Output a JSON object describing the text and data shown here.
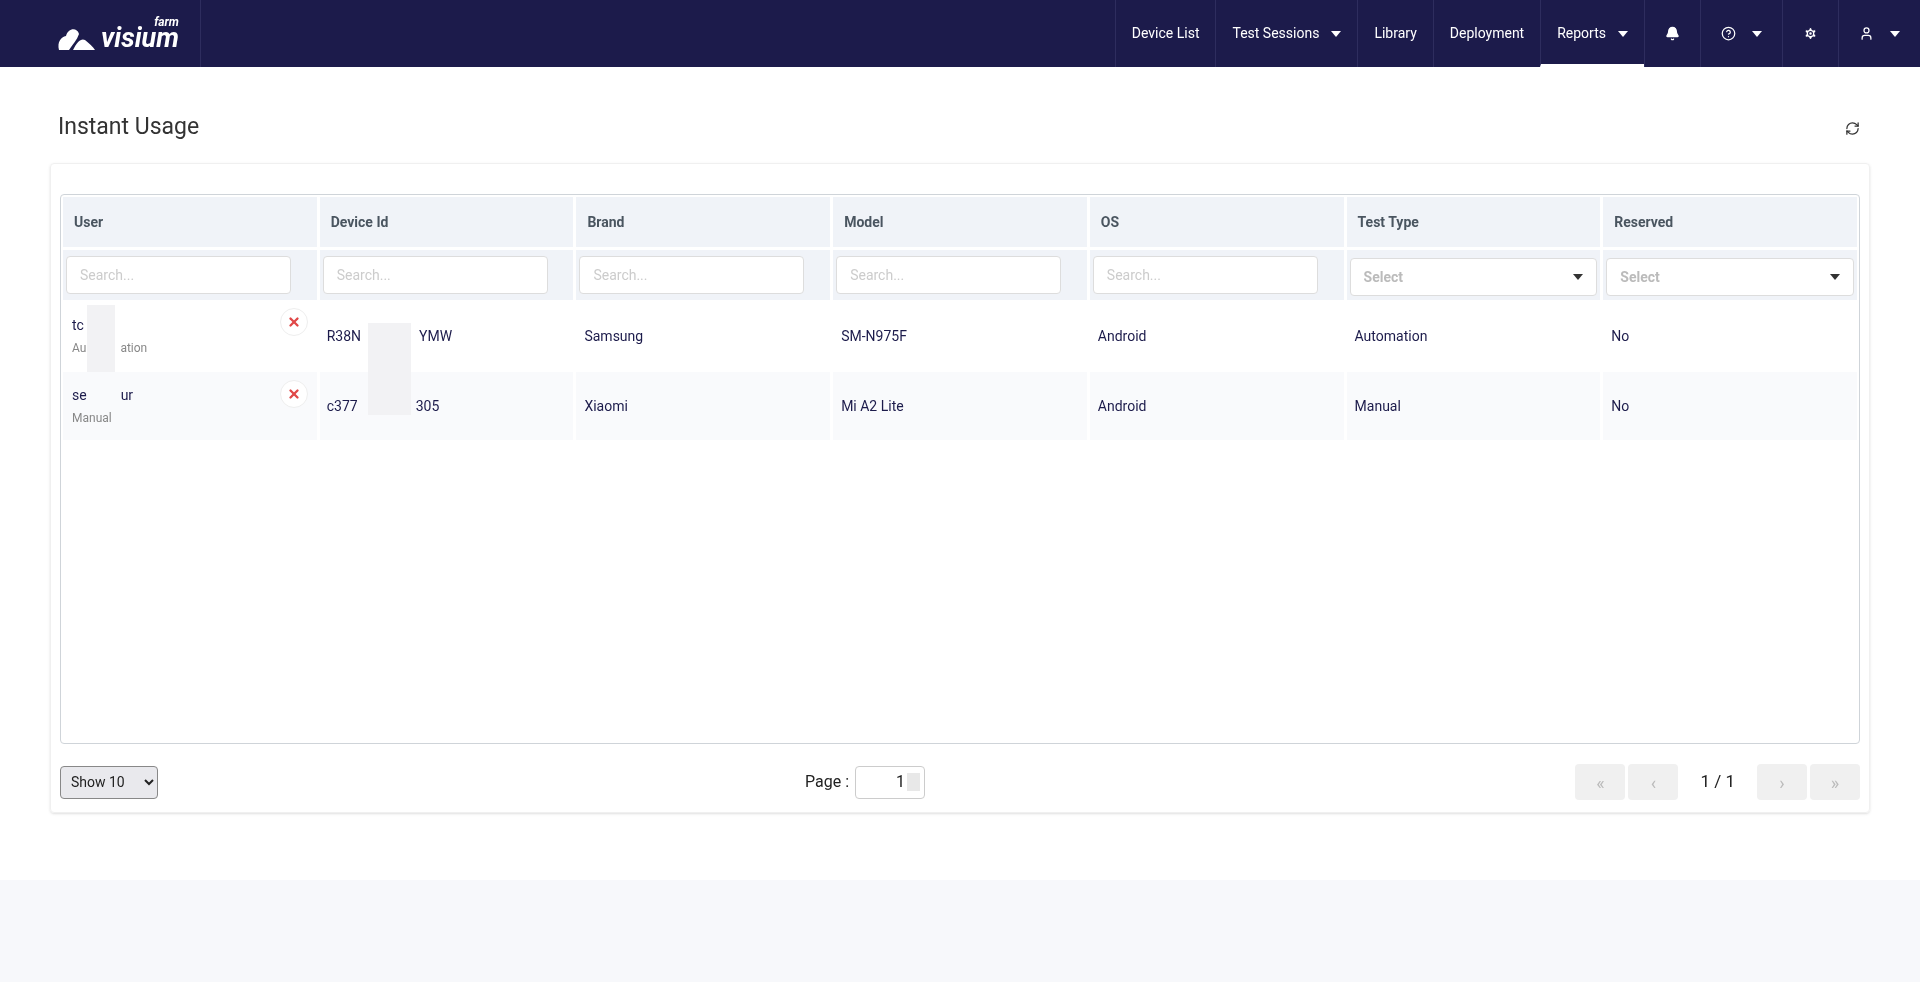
{
  "nav": {
    "logo_small": "farm",
    "logo": "visium",
    "items": [
      {
        "label": "Device List",
        "dropdown": false,
        "selected": false
      },
      {
        "label": "Test Sessions",
        "dropdown": true,
        "selected": false
      },
      {
        "label": "Library",
        "dropdown": false,
        "selected": false
      },
      {
        "label": "Deployment",
        "dropdown": false,
        "selected": false
      },
      {
        "label": "Reports",
        "dropdown": true,
        "selected": true
      }
    ],
    "icons": [
      {
        "kind": "bell",
        "dropdown": false
      },
      {
        "kind": "help",
        "dropdown": true
      },
      {
        "kind": "gear",
        "dropdown": false
      },
      {
        "kind": "user",
        "dropdown": true
      }
    ]
  },
  "page_title": "Instant Usage",
  "table": {
    "columns": [
      {
        "label": "User",
        "kind": "search",
        "placeholder": "Search..."
      },
      {
        "label": "Device Id",
        "kind": "search",
        "placeholder": "Search..."
      },
      {
        "label": "Brand",
        "kind": "search",
        "placeholder": "Search..."
      },
      {
        "label": "Model",
        "kind": "search",
        "placeholder": "Search..."
      },
      {
        "label": "OS",
        "kind": "search",
        "placeholder": "Search..."
      },
      {
        "label": "Test Type",
        "kind": "select",
        "placeholder": "Select"
      },
      {
        "label": "Reserved",
        "kind": "select",
        "placeholder": "Select"
      }
    ],
    "rows": [
      {
        "user": [
          "tc"
        ],
        "user_type": [
          "Au",
          "ation"
        ],
        "device_id": [
          "R38N",
          "YMW"
        ],
        "brand": "Samsung",
        "model": "SM-N975F",
        "os": "Android",
        "test_type": "Automation",
        "reserved": "No"
      },
      {
        "user": [
          "se",
          "ur"
        ],
        "user_type": [
          "Manual"
        ],
        "device_id": [
          "c377",
          "305"
        ],
        "brand": "Xiaomi",
        "model": "Mi A2 Lite",
        "os": "Android",
        "test_type": "Manual",
        "reserved": "No"
      }
    ]
  },
  "footer": {
    "page_size": "Show 10",
    "page_label": "Page :",
    "page_value": "1",
    "page_count": "1 / 1",
    "buttons": [
      "«",
      "‹",
      "›",
      "»"
    ]
  }
}
